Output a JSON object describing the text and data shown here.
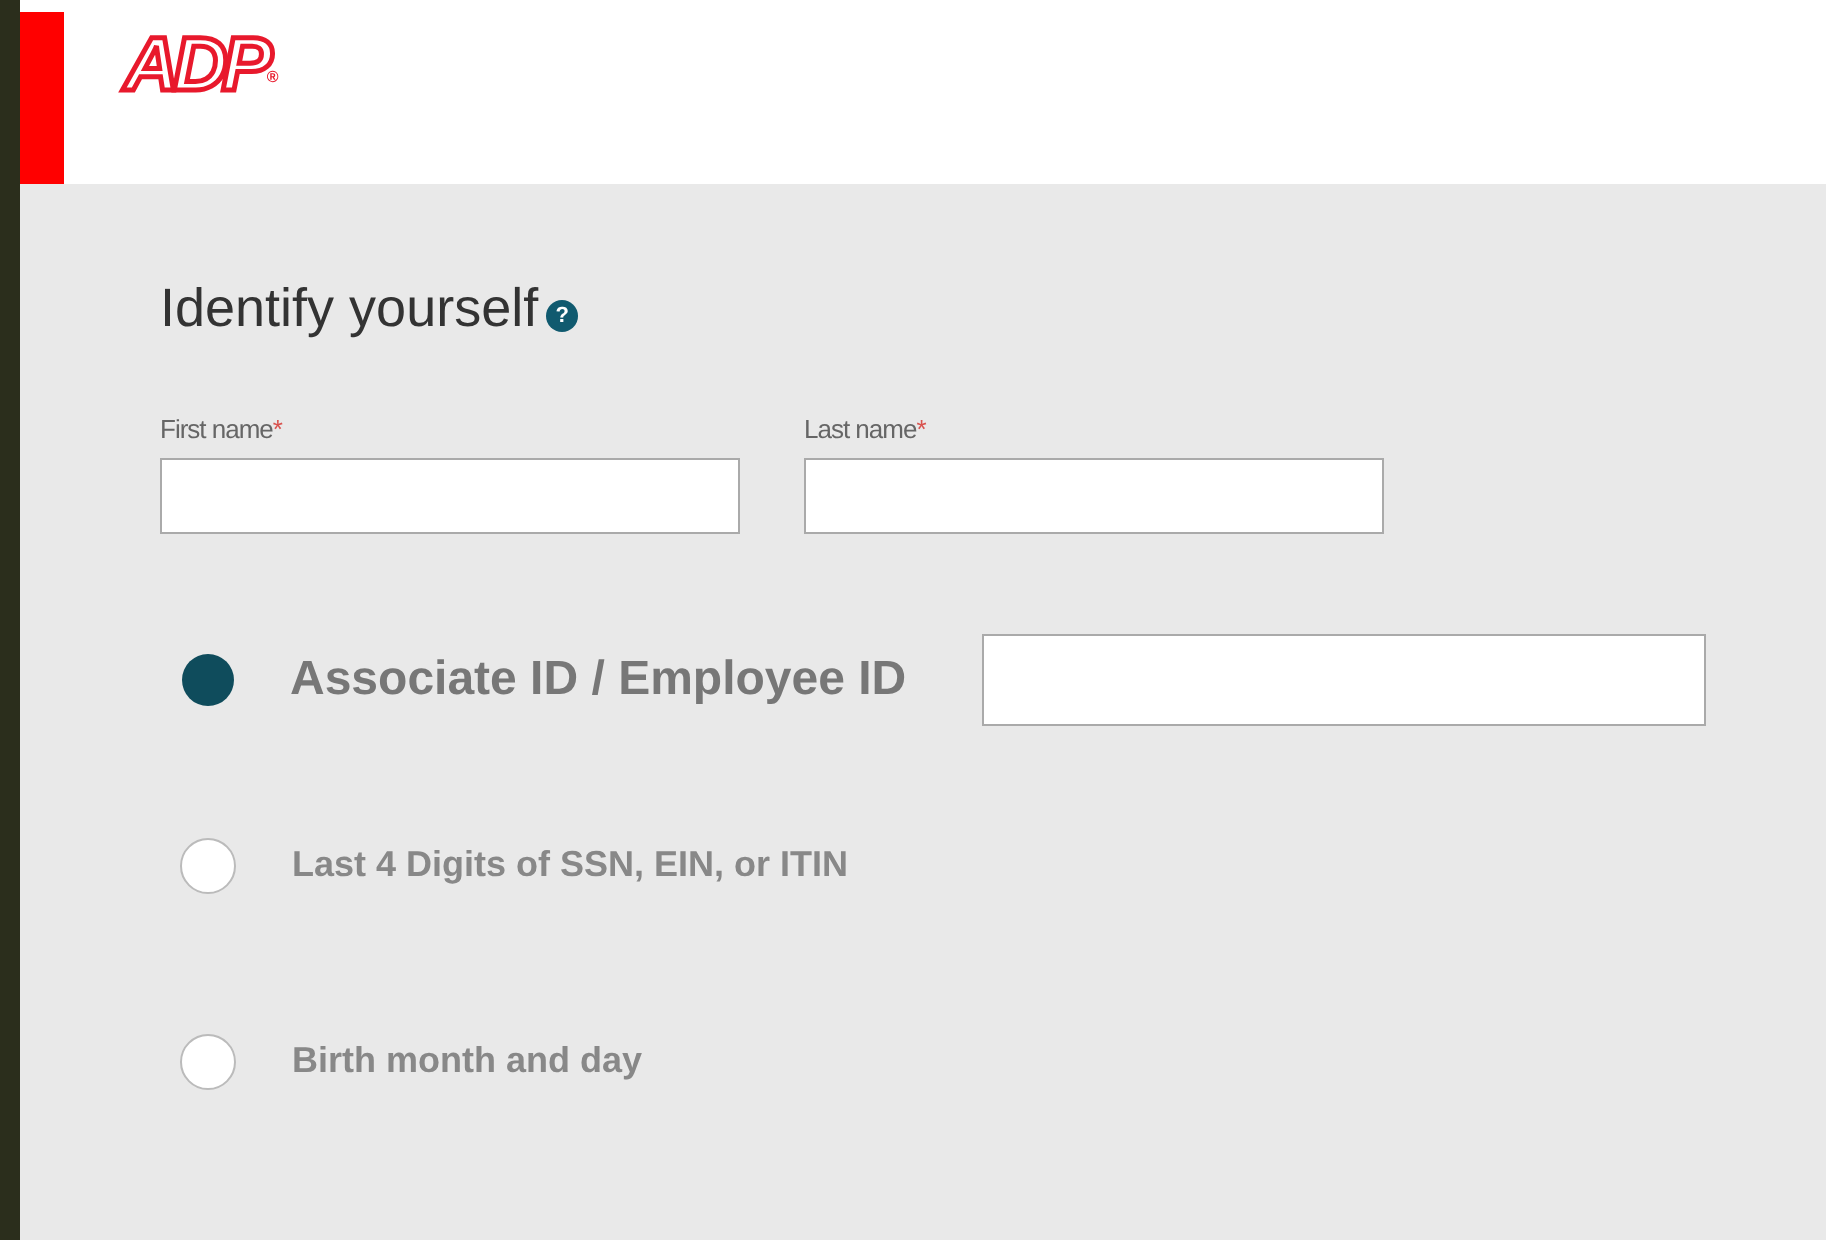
{
  "header": {
    "logo": "ADP",
    "logo_mark": "®"
  },
  "form": {
    "title": "Identify yourself",
    "help": "?",
    "fields": [
      {
        "label": "First name",
        "required": "*"
      },
      {
        "label": "Last name",
        "required": "*"
      }
    ],
    "options": [
      {
        "label": "Associate ID / Employee ID",
        "selected": true
      },
      {
        "label": "Last 4 Digits of SSN, EIN, or ITIN",
        "selected": false
      },
      {
        "label": "Birth month and day",
        "selected": false
      }
    ]
  }
}
